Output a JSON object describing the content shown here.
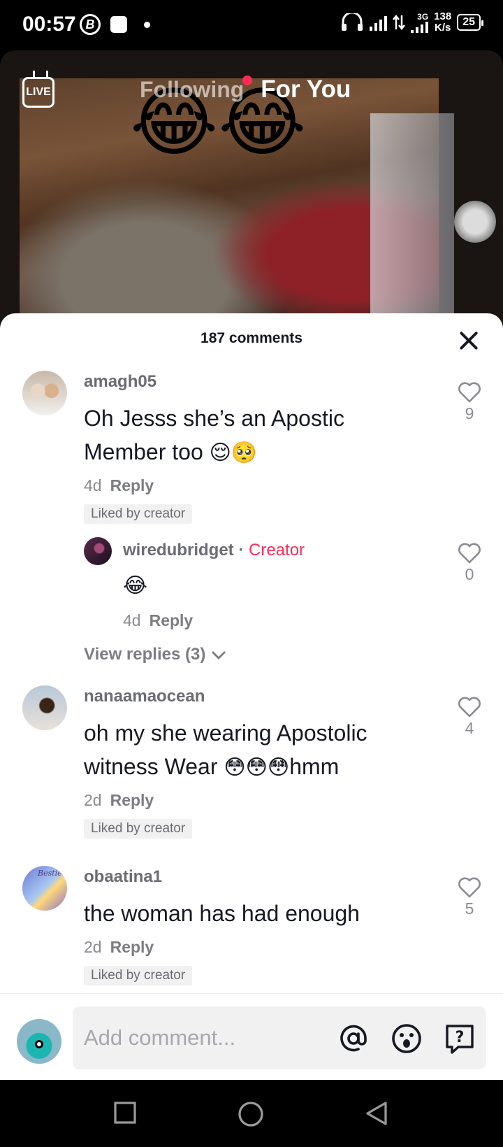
{
  "status_bar": {
    "time": "00:57",
    "b_icon_text": "B",
    "network": "3G",
    "speed_value": "138",
    "speed_unit": "K/s",
    "battery": "25"
  },
  "video": {
    "live_label": "LIVE",
    "tab_following": "Following",
    "tab_for_you": "For You",
    "overlay_emoji": "😂😂"
  },
  "comments_sheet": {
    "title": "187 comments",
    "comments": [
      {
        "username": "amagh05",
        "text_line1": "Oh Jesss she’s an Apostic",
        "text_line2": "Member too",
        "emojis": "😌🥺",
        "age": "4d",
        "reply_label": "Reply",
        "liked_by": "Liked by creator",
        "likes": "9"
      },
      {
        "username": "wiredubridget",
        "separator": "·",
        "creator_label": "Creator",
        "text": "😂",
        "age": "4d",
        "reply_label": "Reply",
        "likes": "0"
      },
      {
        "username": "nanaamaocean",
        "text_line1": "oh my she wearing Apostolic",
        "text_line2_prefix": "witness Wear",
        "emojis": "😳😳😳",
        "text_line2_suffix": "hmm",
        "age": "2d",
        "reply_label": "Reply",
        "liked_by": "Liked by creator",
        "likes": "4"
      },
      {
        "username": "obaatina1",
        "avatar_text": "Bestie",
        "text": "the woman has had enough",
        "age": "2d",
        "reply_label": "Reply",
        "liked_by": "Liked by creator",
        "likes": "5"
      }
    ],
    "view_replies": "View replies (3)"
  },
  "input": {
    "placeholder": "Add comment..."
  }
}
